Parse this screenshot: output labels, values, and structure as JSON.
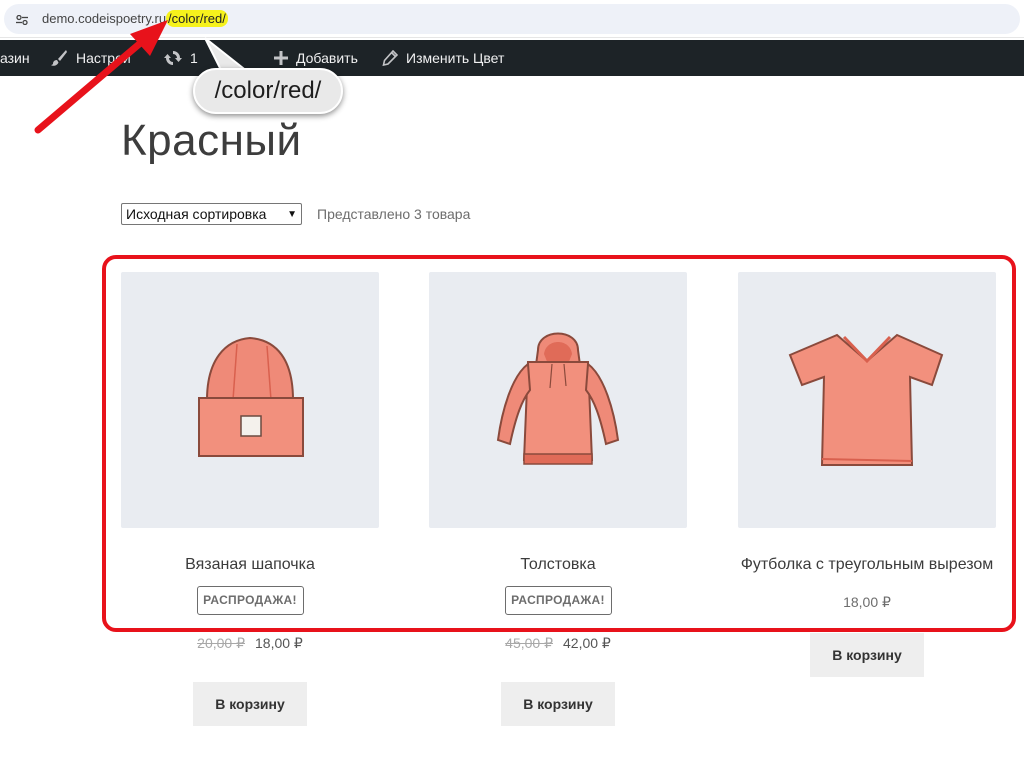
{
  "browser": {
    "url_host": "demo.codeispoetry.ru",
    "url_path": "/color/red/",
    "site_icon": "tune-icon"
  },
  "admin_bar": {
    "items": [
      {
        "label": "азин",
        "icon": ""
      },
      {
        "label": "Настрой",
        "icon": "brush-icon"
      },
      {
        "label": "1",
        "icon": "updates-icon"
      },
      {
        "label": "Добавить",
        "icon": "plus-icon"
      },
      {
        "label": "Изменить Цвет",
        "icon": "pencil-icon"
      }
    ]
  },
  "callout": {
    "text": "/color/red/"
  },
  "page": {
    "title": "Красный",
    "sort": {
      "selected": "Исходная сортировка"
    },
    "result_count": "Представлено 3 товара"
  },
  "products": [
    {
      "title": "Вязаная шапочка",
      "badge": "РАСПРОДАЖА!",
      "price_old": "20,00 ₽",
      "price": "18,00 ₽",
      "button": "В корзину",
      "image": "beanie-image"
    },
    {
      "title": "Толстовка",
      "badge": "РАСПРОДАЖА!",
      "price_old": "45,00 ₽",
      "price": "42,00 ₽",
      "button": "В корзину",
      "image": "hoodie-image"
    },
    {
      "title": "Футболка с треугольным вырезом",
      "badge": "",
      "price_old": "",
      "price": "18,00 ₽",
      "button": "В корзину",
      "image": "tshirt-image"
    }
  ],
  "colors": {
    "accent_red": "#e8121b",
    "highlight_yellow": "#f6f21c",
    "admin_bar_bg": "#1d2327",
    "product_color": "#ef8a78"
  }
}
